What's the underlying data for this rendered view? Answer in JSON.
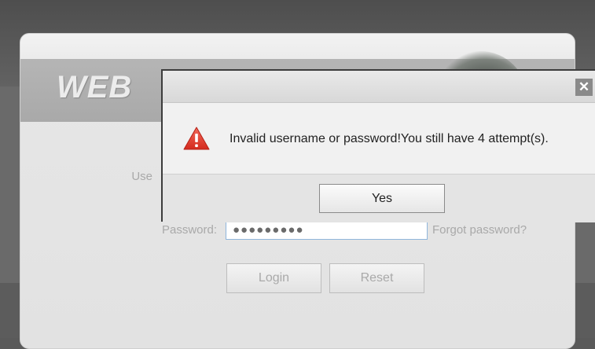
{
  "header": {
    "logo_text": "WEB"
  },
  "login_form": {
    "username_label": "Use",
    "password_label": "Password:",
    "password_value": "●●●●●●●●●",
    "forgot_link": "Forgot password?",
    "login_button": "Login",
    "reset_button": "Reset"
  },
  "dialog": {
    "close_symbol": "✕",
    "icon": "warning-icon",
    "message": "Invalid username or password!You still have 4 attempt(s).",
    "yes_button": "Yes"
  },
  "colors": {
    "warning_red": "#e23b2e",
    "dialog_border": "#3c3c3c",
    "input_border": "#8fb6dc"
  }
}
